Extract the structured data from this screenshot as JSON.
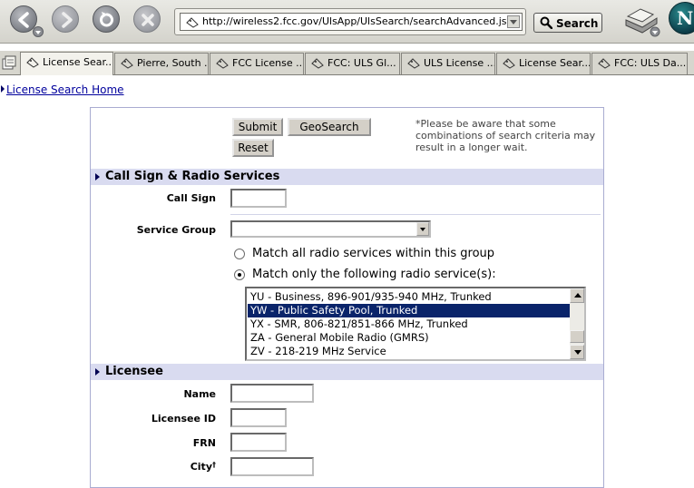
{
  "browser": {
    "url": "http://wireless2.fcc.gov/UlsApp/UlsSearch/searchAdvanced.jsp",
    "search_label": "Search",
    "logo_letter": "N",
    "tabs": [
      {
        "label": "License Sear..."
      },
      {
        "label": "Pierre, South ..."
      },
      {
        "label": "FCC License ..."
      },
      {
        "label": "FCC: ULS Gl..."
      },
      {
        "label": "ULS License ..."
      },
      {
        "label": "License Sear..."
      },
      {
        "label": "FCC: ULS Da..."
      }
    ]
  },
  "page": {
    "home_link": "License Search Home",
    "submit_label": "Submit",
    "geosearch_label": "GeoSearch",
    "reset_label": "Reset",
    "notice": "*Please be aware that some combinations of search criteria may result in a longer wait.",
    "section_callsign": "Call Sign & Radio Services",
    "call_sign_label": "Call Sign",
    "call_sign_value": "",
    "service_group_label": "Service Group",
    "service_group_value": "",
    "radio_all": "Match all radio services within this group",
    "radio_only": "Match only the following radio service(s):",
    "services": [
      "YU - Business, 896-901/935-940 MHz, Trunked",
      "YW - Public Safety Pool, Trunked",
      "YX - SMR, 806-821/851-866 MHz, Trunked",
      "ZA - General Mobile Radio (GMRS)",
      "ZV - 218-219 MHz Service"
    ],
    "selected_service": "YW - Public Safety Pool, Trunked",
    "section_licensee": "Licensee",
    "name_label": "Name",
    "licensee_id_label": "Licensee ID",
    "frn_label": "FRN",
    "city_label": "City",
    "city_mark": "†"
  },
  "colors": {
    "section_bg": "#d9dbf0",
    "selection_bg": "#0a246a",
    "link": "#00009c"
  }
}
